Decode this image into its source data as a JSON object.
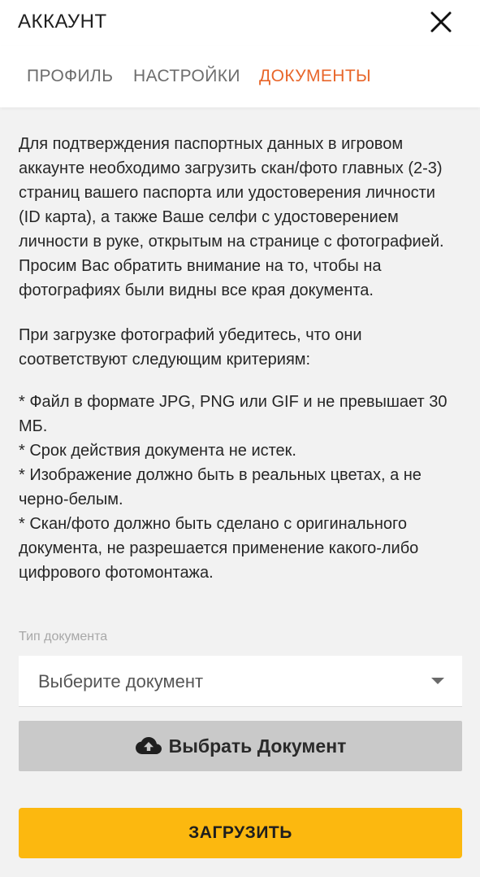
{
  "header": {
    "title": "АККАУНТ",
    "close_icon": "close-icon"
  },
  "tabs": [
    {
      "label": "ПРОФИЛЬ",
      "active": false
    },
    {
      "label": "НАСТРОЙКИ",
      "active": false
    },
    {
      "label": "ДОКУМЕНТЫ",
      "active": true
    }
  ],
  "content": {
    "intro": "Для подтверждения паспортных данных в игровом аккаунте необходимо загрузить скан/фото главных (2-3) страниц вашего паспорта или удостоверения личности (ID карта), а также Ваше селфи с удостоверением личности в руке, открытым на странице с фотографией. Просим Вас обратить внимание на то, чтобы на фотографиях были видны все края документа.",
    "criteria_intro": "При загрузке фотографий убедитесь, что они соответствуют следующим критериям:",
    "criteria": [
      "* Файл в формате JPG, PNG или GIF и не превышает 30 МБ.",
      "* Срок действия документа не истек.",
      "* Изображение должно быть в реальных цветах, а не черно-белым.",
      "* Скан/фото должно быть сделано с оригинального документа, не разрешается применение какого-либо цифрового фотомонтажа."
    ]
  },
  "form": {
    "doc_type_label": "Тип документа",
    "doc_type_value": "Выберите документ",
    "caret_icon": "caret-down-icon",
    "choose_label": "Выбрать Документ",
    "choose_icon": "cloud-upload-icon",
    "upload_label": "ЗАГРУЗИТЬ"
  },
  "colors": {
    "accent": "#e8662a",
    "upload_button": "#fcb80f",
    "choose_button": "#c9c9c9",
    "background": "#f2f2f2"
  }
}
